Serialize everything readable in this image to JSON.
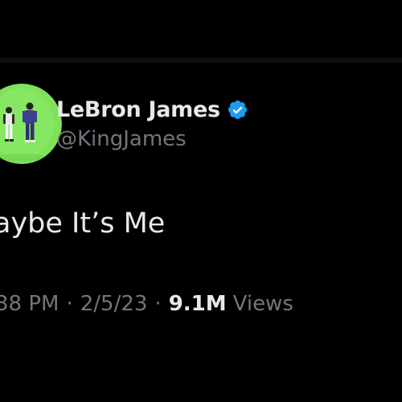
{
  "tweet": {
    "author": {
      "display_name": "LeBron James",
      "handle": "@KingJames",
      "verified": true,
      "avatar_icon": "profile-photo-avatar"
    },
    "text": "aybe It’s Me",
    "meta": {
      "time": "38 PM",
      "separator": "·",
      "date": "2/5/23",
      "views_count": "9.1M",
      "views_label": "Views"
    }
  },
  "colors": {
    "background": "#000000",
    "primary_text": "#e7e9ea",
    "secondary_text": "#71767b",
    "verified_badge": "#1d9bf0",
    "avatar_background": "#7ee35a"
  }
}
